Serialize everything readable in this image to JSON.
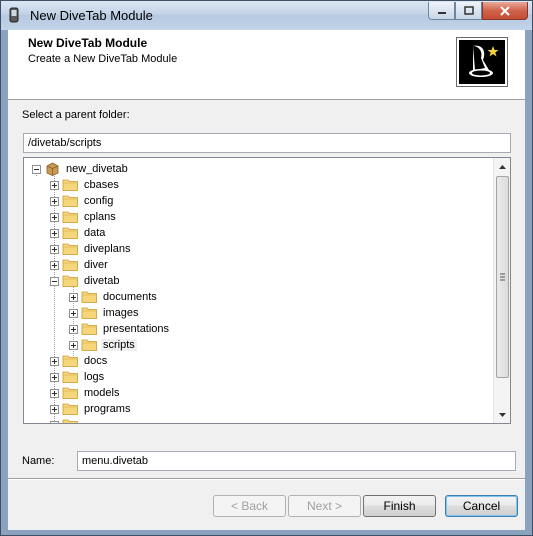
{
  "window": {
    "title": "New DiveTab Module"
  },
  "header": {
    "title": "New DiveTab Module",
    "subtitle": "Create a New DiveTab Module"
  },
  "parent_folder": {
    "label": "Select a parent folder:",
    "value": "/divetab/scripts"
  },
  "tree": {
    "root": "new_divetab",
    "items": [
      {
        "label": "cbases",
        "level": 1,
        "expander": "plus"
      },
      {
        "label": "config",
        "level": 1,
        "expander": "plus"
      },
      {
        "label": "cplans",
        "level": 1,
        "expander": "plus"
      },
      {
        "label": "data",
        "level": 1,
        "expander": "plus"
      },
      {
        "label": "diveplans",
        "level": 1,
        "expander": "plus"
      },
      {
        "label": "diver",
        "level": 1,
        "expander": "plus"
      },
      {
        "label": "divetab",
        "level": 1,
        "expander": "minus"
      },
      {
        "label": "documents",
        "level": 2,
        "expander": "plus"
      },
      {
        "label": "images",
        "level": 2,
        "expander": "plus"
      },
      {
        "label": "presentations",
        "level": 2,
        "expander": "plus"
      },
      {
        "label": "scripts",
        "level": 2,
        "expander": "plus",
        "selected": true
      },
      {
        "label": "docs",
        "level": 1,
        "expander": "plus"
      },
      {
        "label": "logs",
        "level": 1,
        "expander": "plus"
      },
      {
        "label": "models",
        "level": 1,
        "expander": "plus"
      },
      {
        "label": "programs",
        "level": 1,
        "expander": "plus"
      }
    ]
  },
  "name_field": {
    "label": "Name:",
    "value": "menu.divetab"
  },
  "buttons": {
    "back": "< Back",
    "next": "Next >",
    "finish": "Finish",
    "cancel": "Cancel"
  },
  "colors": {
    "folder": "#f5d67b",
    "selection": "#f0f0f0"
  }
}
